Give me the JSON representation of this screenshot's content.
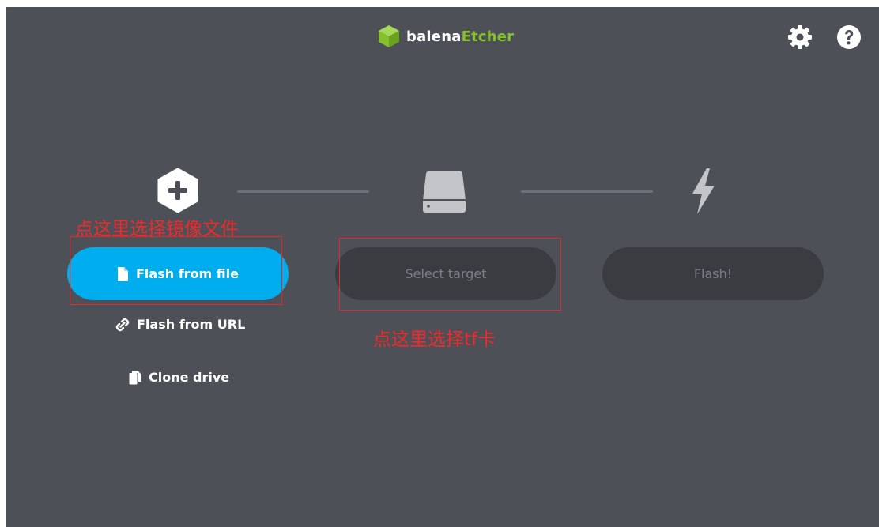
{
  "app": {
    "logo_prefix": "balena",
    "logo_accent": "Etcher",
    "accent_color": "#85c12c",
    "brand_blue": "#00aeef",
    "background": "#4d5057"
  },
  "header": {
    "settings_icon": "gear-icon",
    "help_icon": "question-circle-icon"
  },
  "steps": {
    "source": {
      "icon": "plus-hexagon-icon",
      "button_label": "Flash from file",
      "button_icon": "file-icon"
    },
    "target": {
      "icon": "drive-icon",
      "button_label": "Select target"
    },
    "flash": {
      "icon": "lightning-icon",
      "button_label": "Flash!"
    }
  },
  "source_options": {
    "url_label": "Flash from URL",
    "url_icon": "link-icon",
    "clone_label": "Clone drive",
    "clone_icon": "copy-icon"
  },
  "annotations": {
    "source_note": "点这里选择镜像文件",
    "target_note": "点这里选择tf卡",
    "annotation_color": "#e02b2b"
  }
}
